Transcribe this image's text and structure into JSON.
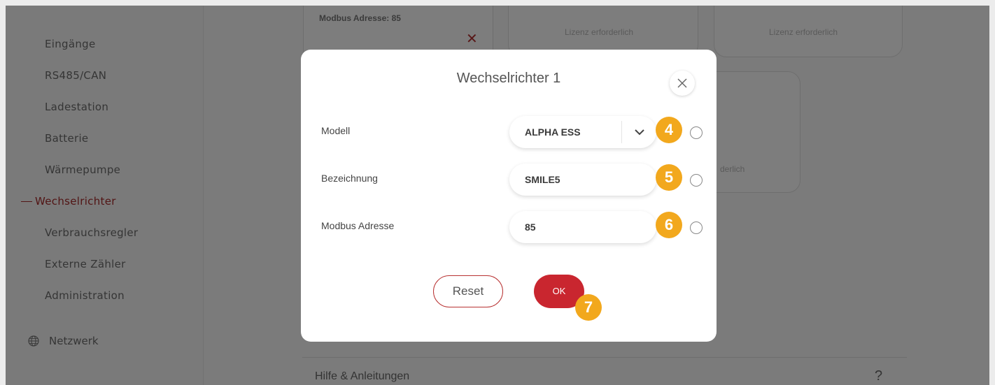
{
  "sidebar": {
    "items": [
      {
        "label": "Eingänge"
      },
      {
        "label": "RS485/CAN"
      },
      {
        "label": "Ladestation"
      },
      {
        "label": "Batterie"
      },
      {
        "label": "Wärmepumpe"
      },
      {
        "label": "Wechselrichter",
        "active": true
      },
      {
        "label": "Verbrauchsregler"
      },
      {
        "label": "Externe Zähler"
      },
      {
        "label": "Administration"
      }
    ],
    "network_label": "Netzwerk"
  },
  "background": {
    "card1_text": "Modbus Adresse: 85",
    "card2_text": "Lizenz erforderlich",
    "card3_text": "Lizenz erforderlich",
    "card4_text": "derlich",
    "section_title": "Hilfe & Anleitungen",
    "section_icon": "?"
  },
  "dialog": {
    "title": "Wechselrichter 1",
    "fields": {
      "model": {
        "label": "Modell",
        "value": "ALPHA ESS"
      },
      "name": {
        "label": "Bezeichnung",
        "value": "SMILE5"
      },
      "modbus": {
        "label": "Modbus Adresse",
        "value": "85"
      }
    },
    "reset_label": "Reset",
    "ok_label": "OK"
  },
  "badges": [
    "4",
    "5",
    "6",
    "7"
  ],
  "colors": {
    "accent": "#c9262f",
    "badge": "#f2a81d",
    "active_nav": "#a52a2a"
  }
}
